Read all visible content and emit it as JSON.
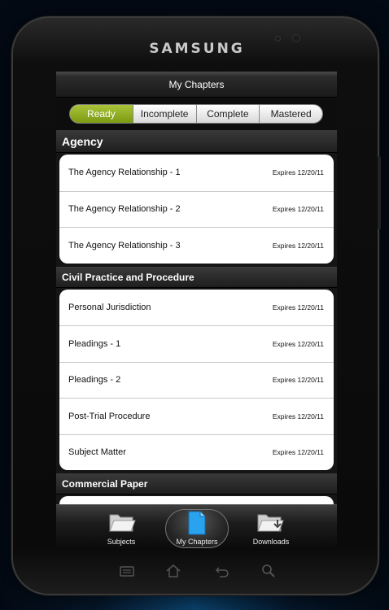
{
  "device": {
    "brand": "SAMSUNG"
  },
  "screen": {
    "title": "My Chapters",
    "tabs": [
      {
        "label": "Ready",
        "active": true
      },
      {
        "label": "Incomplete",
        "active": false
      },
      {
        "label": "Complete",
        "active": false
      },
      {
        "label": "Mastered",
        "active": false
      }
    ],
    "sections": [
      {
        "title": "Agency",
        "items": [
          {
            "title": "The Agency Relationship - 1",
            "expires": "Expires 12/20/11"
          },
          {
            "title": "The Agency Relationship - 2",
            "expires": "Expires 12/20/11"
          },
          {
            "title": "The Agency Relationship - 3",
            "expires": "Expires 12/20/11"
          }
        ]
      },
      {
        "title": "Civil Practice and Procedure",
        "items": [
          {
            "title": "Personal Jurisdiction",
            "expires": "Expires 12/20/11"
          },
          {
            "title": "Pleadings - 1",
            "expires": "Expires 12/20/11"
          },
          {
            "title": "Pleadings - 2",
            "expires": "Expires 12/20/11"
          },
          {
            "title": "Post-Trial Procedure",
            "expires": "Expires 12/20/11"
          },
          {
            "title": "Subject Matter",
            "expires": "Expires 12/20/11"
          }
        ]
      },
      {
        "title": "Commercial Paper",
        "items": []
      }
    ],
    "bottom_nav": [
      {
        "label": "Subjects",
        "icon": "folder-open-icon"
      },
      {
        "label": "My Chapters",
        "icon": "document-icon",
        "active": true
      },
      {
        "label": "Downloads",
        "icon": "folder-download-icon"
      }
    ]
  },
  "hardware_keys": [
    "menu-icon",
    "home-icon",
    "back-icon",
    "search-icon"
  ],
  "colors": {
    "accent": "#8fae22",
    "background": "#151515"
  }
}
